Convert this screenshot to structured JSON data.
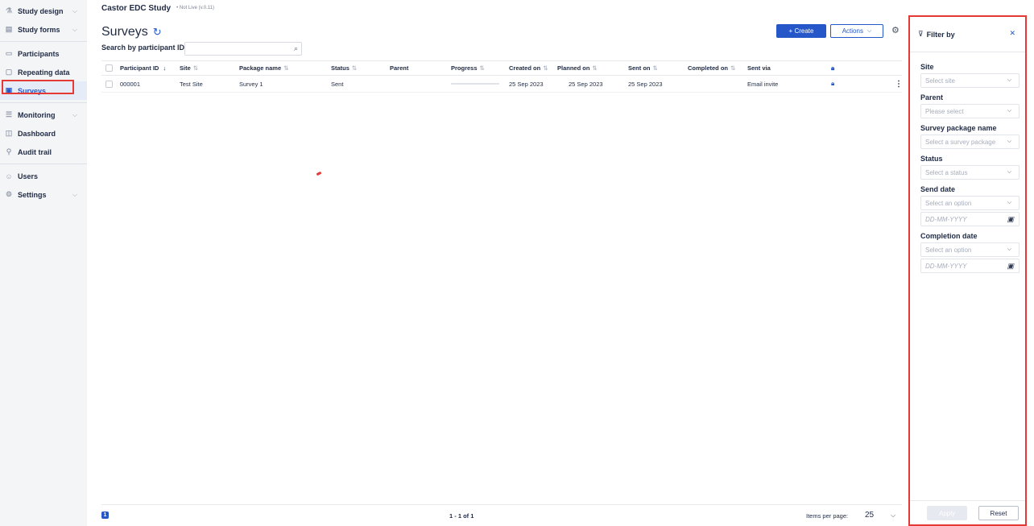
{
  "app": {
    "study_name": "Castor EDC Study",
    "live_status": "• Not Live (v.0.11)"
  },
  "sidebar": {
    "items": [
      {
        "label": "Study design",
        "icon": "study-design-icon",
        "has_chevron": true
      },
      {
        "label": "Study forms",
        "icon": "study-forms-icon",
        "has_chevron": true
      },
      {
        "label": "Participants",
        "icon": "folder-icon",
        "has_chevron": false
      },
      {
        "label": "Repeating data",
        "icon": "repeating-data-icon",
        "has_chevron": false
      },
      {
        "label": "Surveys",
        "icon": "survey-icon",
        "has_chevron": false,
        "active": true
      },
      {
        "label": "Monitoring",
        "icon": "monitoring-icon",
        "has_chevron": true
      },
      {
        "label": "Dashboard",
        "icon": "dashboard-icon",
        "has_chevron": false
      },
      {
        "label": "Audit trail",
        "icon": "audit-trail-icon",
        "has_chevron": false
      },
      {
        "label": "Users",
        "icon": "users-icon",
        "has_chevron": false
      },
      {
        "label": "Settings",
        "icon": "settings-icon",
        "has_chevron": true
      }
    ]
  },
  "main": {
    "title": "Surveys",
    "search_label": "Search by participant ID",
    "search_value": "",
    "create_label": "+ Create",
    "actions_label": "Actions",
    "table": {
      "headers": [
        "Participant ID",
        "Site",
        "Package name",
        "Status",
        "Parent",
        "Progress",
        "Created on",
        "Planned on",
        "Sent on",
        "Completed on",
        "Sent via"
      ],
      "rows": [
        {
          "participant_id": "000001",
          "site": "Test Site",
          "package_name": "Survey 1",
          "status": "Sent",
          "parent": "",
          "progress": 0,
          "created_on": "25 Sep 2023",
          "planned_on": "25 Sep 2023",
          "sent_on": "25 Sep 2023",
          "completed_on": "",
          "sent_via": "Email invite"
        }
      ]
    },
    "pagination": {
      "current_page": "1",
      "range": "1 - 1 of 1",
      "items_per_page_label": "Items per page:",
      "items_per_page": "25"
    }
  },
  "filter": {
    "title": "Filter by",
    "site_label": "Site",
    "site_placeholder": "Select site",
    "parent_label": "Parent",
    "parent_placeholder": "Please select",
    "package_label": "Survey package name",
    "package_placeholder": "Select a survey package",
    "status_label": "Status",
    "status_placeholder": "Select a status",
    "send_date_label": "Send date",
    "send_date_option_placeholder": "Select an option",
    "send_date_placeholder": "DD-MM-YYYY",
    "completion_date_label": "Completion date",
    "completion_date_option_placeholder": "Select an option",
    "completion_date_placeholder": "DD-MM-YYYY",
    "apply_label": "Apply",
    "reset_label": "Reset"
  },
  "colors": {
    "accent": "#2557c8",
    "highlight": "#e53935"
  }
}
